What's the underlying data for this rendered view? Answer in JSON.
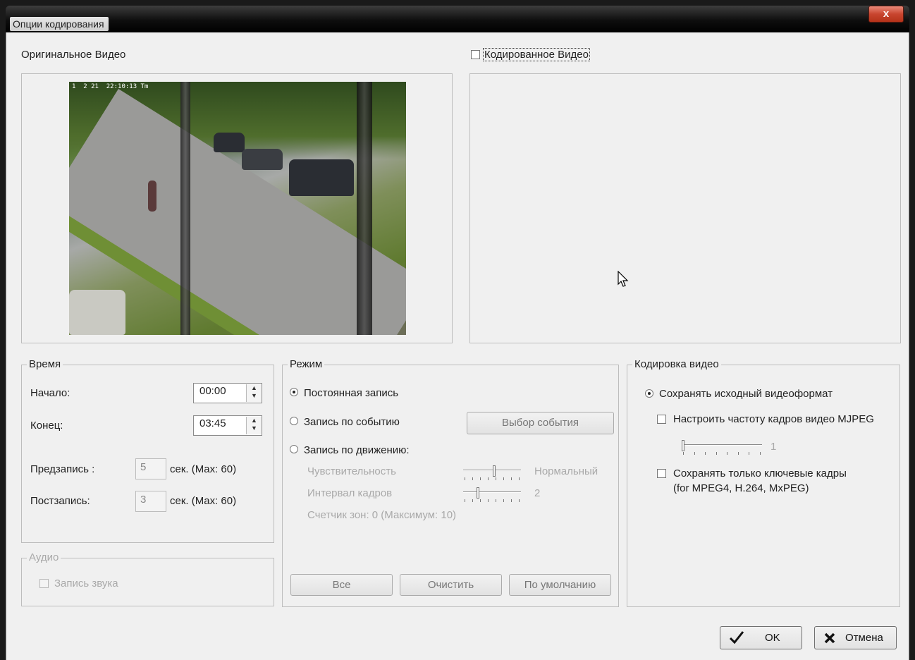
{
  "window": {
    "title": "Опции кодирования",
    "close_label": "x"
  },
  "original_video": {
    "label": "Оригинальное Видео",
    "osd_text": "1  2 21  22:10:13 Tm"
  },
  "encoded_video": {
    "label": "Кодированное Видео",
    "checked": false
  },
  "time": {
    "title": "Время",
    "start_label": "Начало:",
    "start_value": "00:00",
    "end_label": "Конец:",
    "end_value": "03:45",
    "prerecord_label": "Предзапись :",
    "prerecord_value": "5",
    "prerecord_unit": "сек.  (Max: 60)",
    "postrecord_label": "Постзапись:",
    "postrecord_value": "3",
    "postrecord_unit": "сек.  (Max: 60)"
  },
  "audio": {
    "title": "Аудио",
    "record_sound_label": "Запись звука",
    "checked": false
  },
  "mode": {
    "title": "Режим",
    "constant_label": "Постоянная запись",
    "event_label": "Запись по событию",
    "event_button": "Выбор события",
    "motion_label": "Запись по движению:",
    "sensitivity_label": "Чувствительность",
    "sensitivity_value": "Нормальный",
    "sensitivity_level": 0.55,
    "frame_interval_label": "Интервал кадров",
    "frame_interval_value": "2",
    "frame_interval_level": 0.25,
    "zone_counter": "Счетчик зон: 0  (Максимум: 10)",
    "btn_all": "Все",
    "btn_clear": "Очистить",
    "btn_default": "По умолчанию",
    "selected": "constant"
  },
  "video_encoding": {
    "title": "Кодировка видео",
    "keep_format_label": "Сохранять исходный видеоформат",
    "mjpeg_rate_label": "Настроить частоту кадров видео MJPEG",
    "mjpeg_rate_value": "1",
    "mjpeg_rate_level": 0.0,
    "keyframes_label": "Сохранять только ключевые кадры",
    "keyframes_note": "(for MPEG4, H.264, MxPEG)"
  },
  "footer": {
    "ok_label": "OK",
    "cancel_label": "Отмена"
  },
  "icons": {
    "ok": "checkmark-icon",
    "cancel": "x-mark-icon",
    "cursor": "mouse-cursor-icon"
  }
}
